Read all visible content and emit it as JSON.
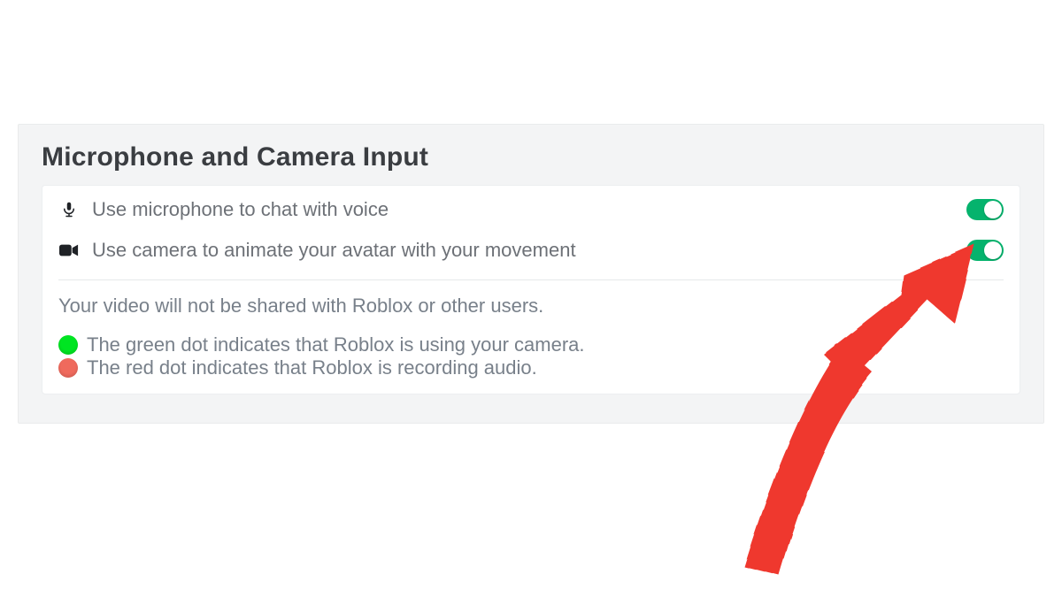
{
  "section": {
    "title": "Microphone and Camera Input"
  },
  "settings": {
    "microphone": {
      "label": "Use microphone to chat with voice",
      "icon": "microphone-icon",
      "enabled": true
    },
    "camera": {
      "label": "Use camera to animate your avatar with your movement",
      "icon": "video-camera-icon",
      "enabled": true
    }
  },
  "info": {
    "disclaimer": "Your video will not be shared with Roblox or other users.",
    "legend": {
      "green": {
        "color": "#00e522",
        "text": "The green dot indicates that Roblox is using your camera."
      },
      "red": {
        "color": "#ef6a5d",
        "text": "The red dot indicates that Roblox is recording audio."
      }
    }
  },
  "colors": {
    "accent": "#05b36d",
    "annotation": "#ef382e",
    "text_muted": "#78808a"
  },
  "annotation": {
    "type": "pointer-arrow",
    "target": "camera-toggle"
  }
}
